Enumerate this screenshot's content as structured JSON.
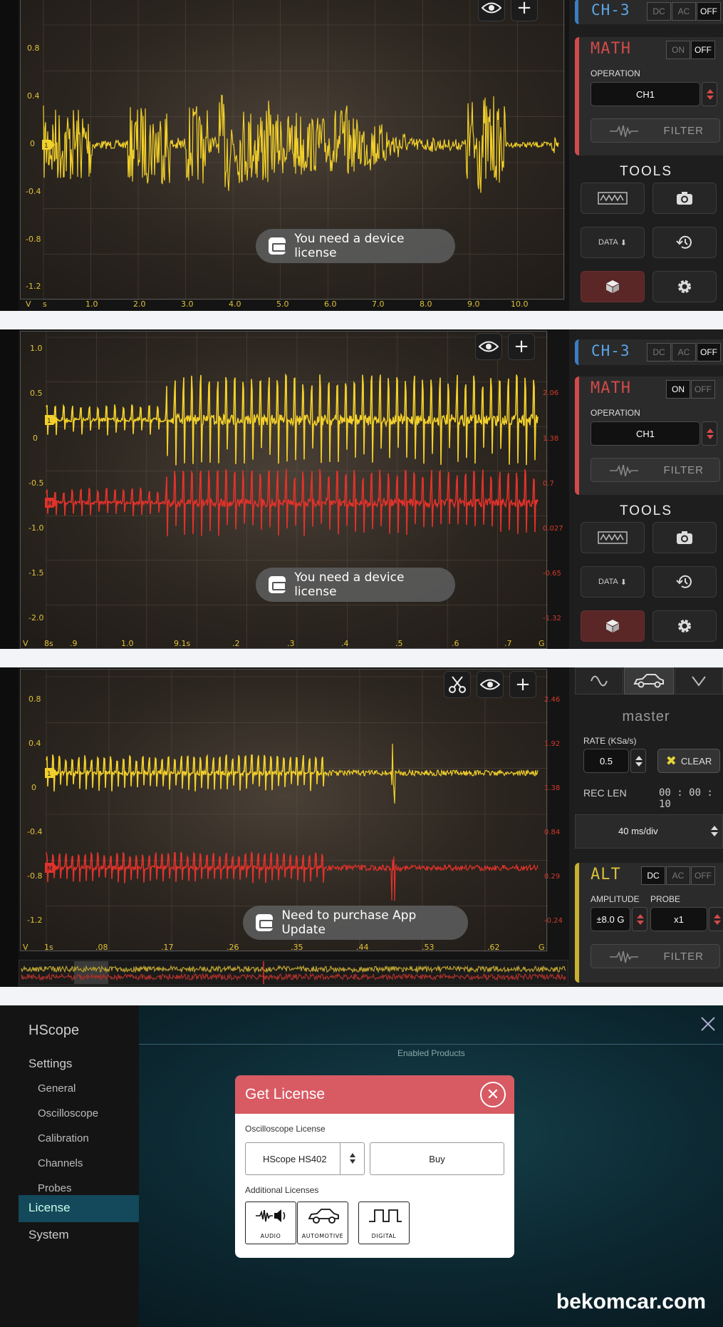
{
  "colors": {
    "trace_yellow": "#f2d02a",
    "trace_red": "#e0322b",
    "ch3_blue": "#5aa6e8",
    "math_red": "#d24a4a",
    "dialog_head": "#d85a63"
  },
  "icons": [
    "eye-icon",
    "plus-icon",
    "scissors-icon",
    "camera-icon",
    "history-icon",
    "gear-icon",
    "cube-icon",
    "close-icon",
    "car-icon",
    "sine-icon"
  ],
  "panel1": {
    "y_labels": [
      "0.8",
      "0.4",
      "0",
      "-0.4",
      "-0.8",
      "-1.2"
    ],
    "x_labels": [
      "V",
      "s",
      "1.0",
      "2.0",
      "3.0",
      "4.0",
      "5.0",
      "6.0",
      "7.0",
      "8.0",
      "9.0",
      "10.0"
    ],
    "toast": "You need a device license",
    "ch3": {
      "label": "CH-3",
      "dc": "DC",
      "ac": "AC",
      "off": "OFF"
    },
    "math": {
      "title": "MATH",
      "on": "ON",
      "off": "OFF",
      "operation_label": "OPERATION",
      "operation_value": "CH1",
      "filter": "FILTER"
    },
    "tools": {
      "title": "TOOLS",
      "data": "DATA"
    }
  },
  "panel2": {
    "y_labels": [
      "1.0",
      "0.5",
      "0",
      "-0.5",
      "-1.0",
      "-1.5",
      "-2.0"
    ],
    "y_labels_right": [
      "2.06",
      "1.38",
      "0.7",
      "0.027",
      "-0.65",
      "-1.32"
    ],
    "x_labels": [
      "V",
      "8s",
      ".9",
      "1.0",
      "9.1s",
      ".2",
      ".3",
      ".4",
      ".5",
      ".6",
      ".7",
      "G"
    ],
    "toast": "You need a device license",
    "ch3": {
      "label": "CH-3",
      "dc": "DC",
      "ac": "AC",
      "off": "OFF"
    },
    "math": {
      "title": "MATH",
      "on": "ON",
      "off": "OFF",
      "operation_label": "OPERATION",
      "operation_value": "CH1",
      "filter": "FILTER"
    },
    "tools": {
      "title": "TOOLS",
      "data": "DATA"
    }
  },
  "panel3": {
    "y_labels": [
      "0.8",
      "0.4",
      "0",
      "-0.4",
      "-0.8",
      "-1.2"
    ],
    "y_labels_right": [
      "2.46",
      "1.92",
      "1.38",
      "0.84",
      "0.29",
      "-0.24"
    ],
    "x_labels": [
      "V",
      "1s",
      ".08",
      ".17",
      ".26",
      ".35",
      ".44",
      ".53",
      ".62",
      "G"
    ],
    "toast": "Need to purchase App Update",
    "master": "master",
    "rate_label": "RATE (KSa/s)",
    "rate_value": "0.5",
    "clear": "CLEAR",
    "reclen_label": "REC LEN",
    "reclen_value": "00 : 00 : 10",
    "timebase": "40 ms/div",
    "alt": {
      "title": "ALT",
      "dc": "DC",
      "ac": "AC",
      "off": "OFF",
      "amplitude_label": "AMPLITUDE",
      "probe_label": "PROBE",
      "amplitude_value": "±8.0 G",
      "probe_value": "x1",
      "filter": "FILTER"
    }
  },
  "settings": {
    "brand": "HScope",
    "menu": {
      "settings": "Settings",
      "general": "General",
      "oscilloscope": "Oscilloscope",
      "calibration": "Calibration",
      "channels": "Channels",
      "probes": "Probes",
      "license": "License",
      "system": "System"
    },
    "enabled_products": "Enabled Products",
    "dialog": {
      "title": "Get License",
      "osc_label": "Oscilloscope License",
      "osc_value": "HScope HS402",
      "buy": "Buy",
      "additional_label": "Additional Licenses",
      "audio": "AUDIO",
      "automotive": "AUTOMOTIVE",
      "digital": "DIGITAL"
    },
    "watermark": "bekomcar.com"
  }
}
